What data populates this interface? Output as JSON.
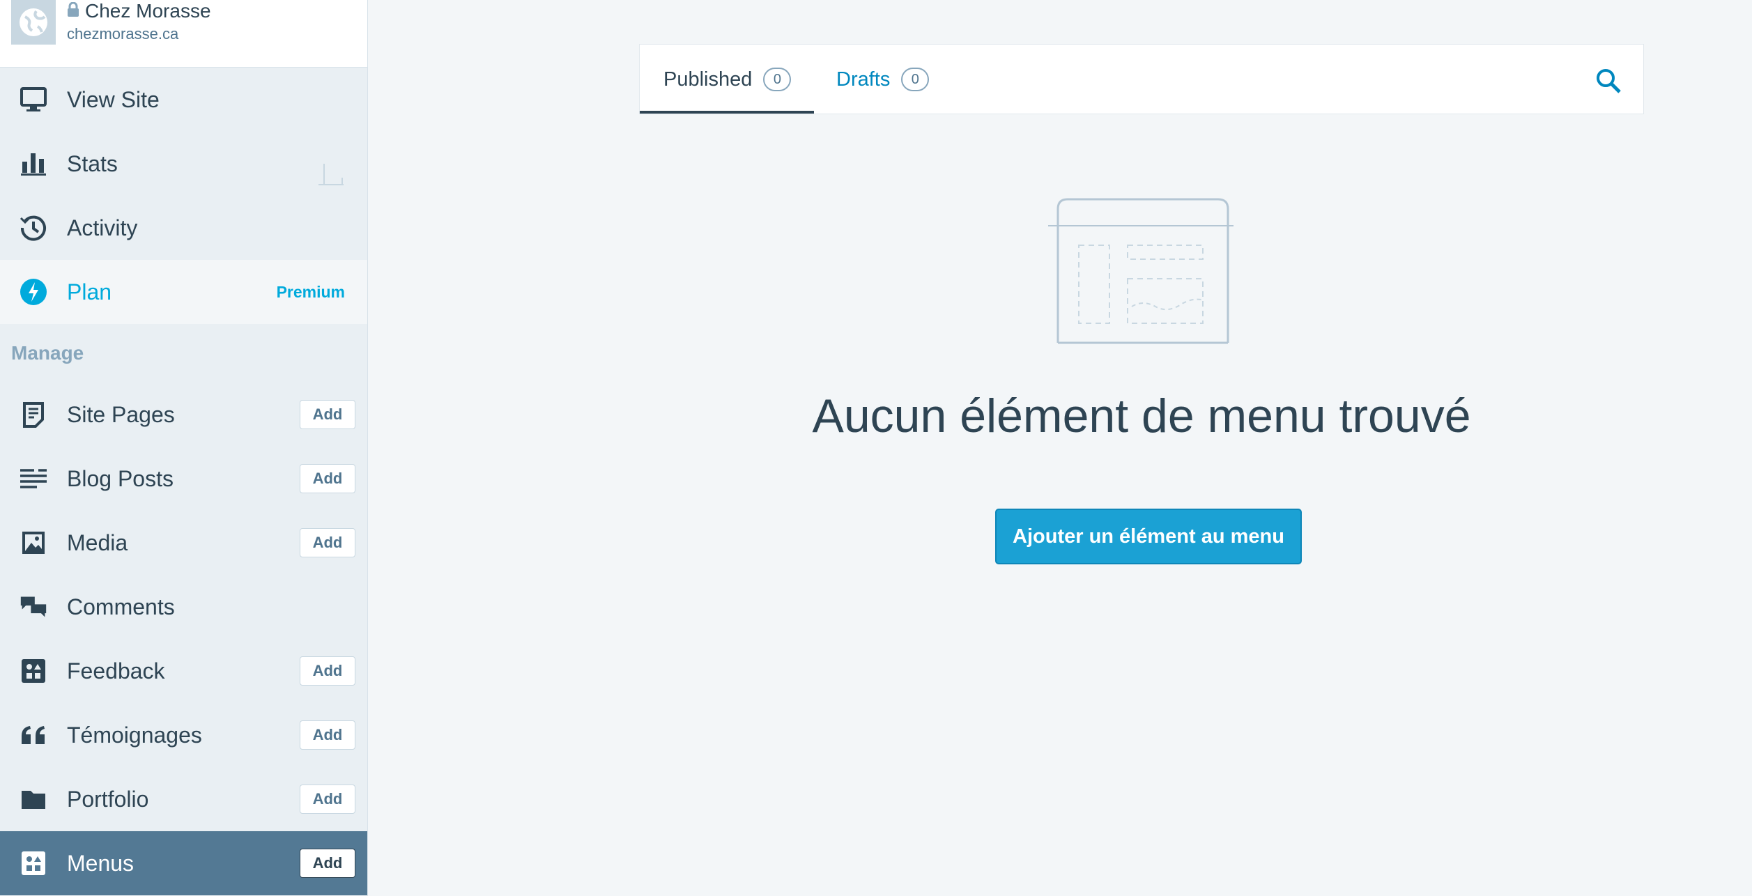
{
  "site": {
    "title": "Chez Morasse",
    "url": "chezmorasse.ca"
  },
  "sidebar": {
    "items": [
      {
        "label": "View Site",
        "icon": "monitor-icon"
      },
      {
        "label": "Stats",
        "icon": "stats-icon"
      },
      {
        "label": "Activity",
        "icon": "history-icon"
      },
      {
        "label": "Plan",
        "icon": "plan-icon",
        "badge": "Premium"
      }
    ],
    "manage_label": "Manage",
    "manage_items": [
      {
        "label": "Site Pages",
        "icon": "pages-icon",
        "add": "Add"
      },
      {
        "label": "Blog Posts",
        "icon": "posts-icon",
        "add": "Add"
      },
      {
        "label": "Media",
        "icon": "image-icon",
        "add": "Add"
      },
      {
        "label": "Comments",
        "icon": "comments-icon"
      },
      {
        "label": "Feedback",
        "icon": "feedback-icon",
        "add": "Add"
      },
      {
        "label": "Témoignages",
        "icon": "quote-icon",
        "add": "Add"
      },
      {
        "label": "Portfolio",
        "icon": "folder-icon",
        "add": "Add"
      },
      {
        "label": "Menus",
        "icon": "menus-icon",
        "add": "Add"
      }
    ]
  },
  "tabs": [
    {
      "label": "Published",
      "count": "0"
    },
    {
      "label": "Drafts",
      "count": "0"
    }
  ],
  "empty": {
    "title": "Aucun élément de menu trouvé",
    "cta": "Ajouter un élément au menu"
  },
  "colors": {
    "accent": "#00aadc",
    "selected": "#537994",
    "button": "#1ba1d4"
  }
}
